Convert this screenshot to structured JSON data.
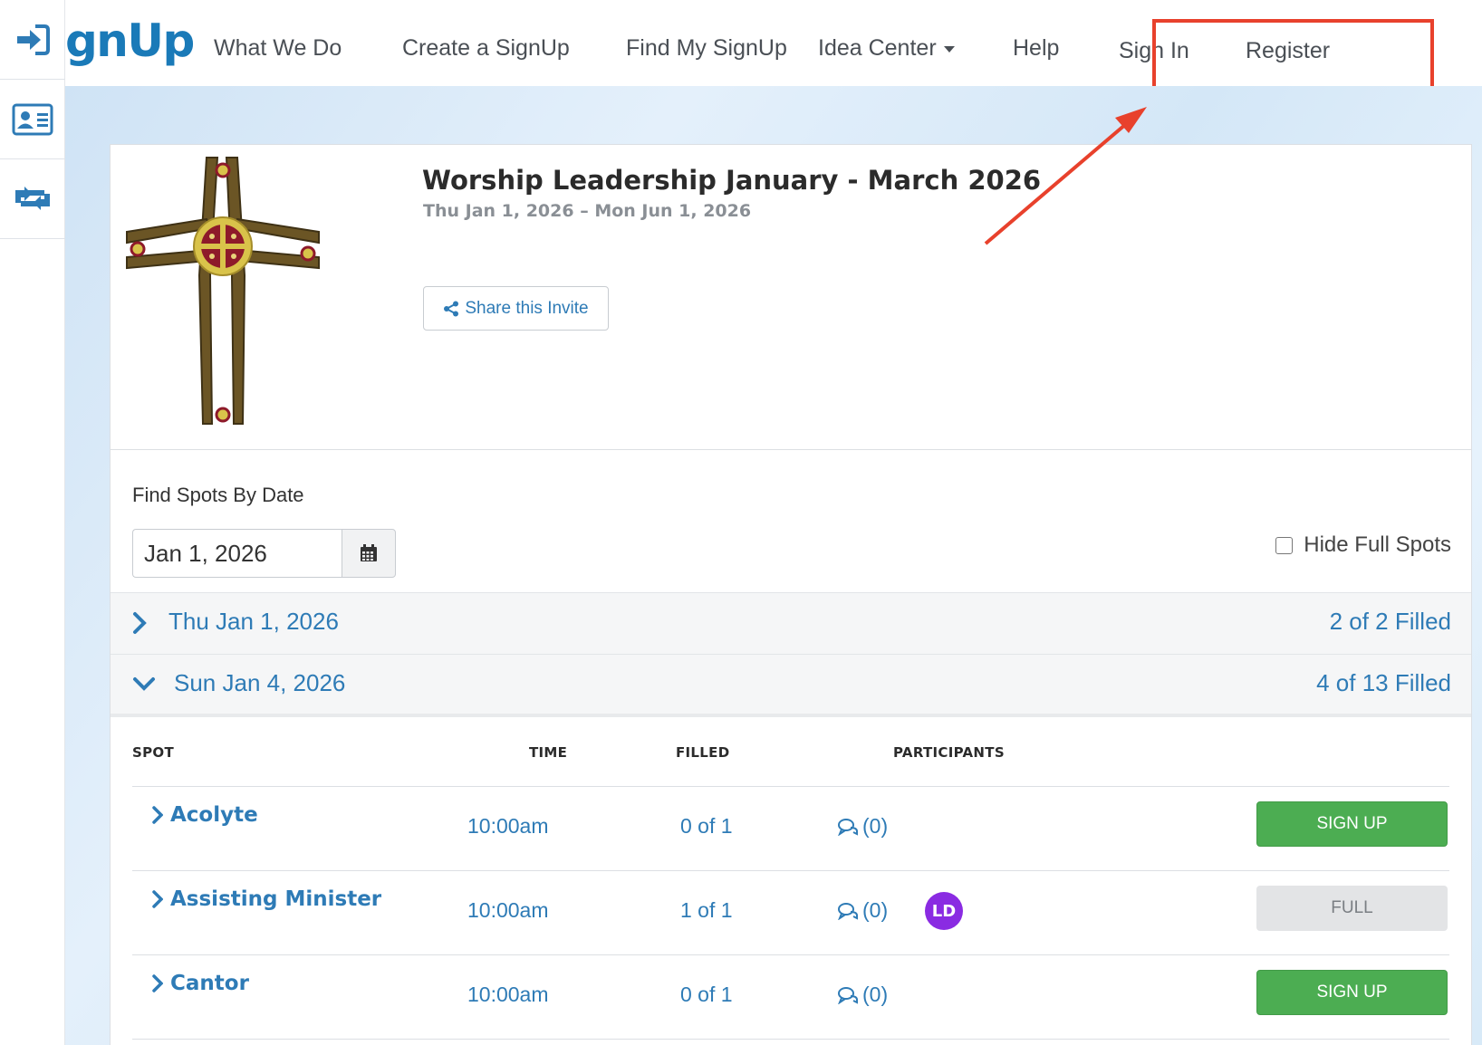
{
  "rail": {
    "items": [
      {
        "icon": "sign-in-icon"
      },
      {
        "icon": "contact-card-icon"
      },
      {
        "icon": "swap-icon"
      }
    ]
  },
  "nav": {
    "logo_text": "gnUp",
    "items": [
      {
        "label": "What We Do"
      },
      {
        "label": "Create a SignUp"
      },
      {
        "label": "Find My SignUp"
      },
      {
        "label": "Idea Center"
      },
      {
        "label": "Help"
      },
      {
        "label": "Sign In"
      },
      {
        "label": "Register"
      }
    ]
  },
  "event": {
    "title": "Worship Leadership January - March 2026",
    "dates": "Thu Jan 1, 2026 – Mon Jun 1, 2026",
    "share_label": "Share this Invite"
  },
  "filters": {
    "find_label": "Find Spots By Date",
    "date_value": "Jan 1, 2026",
    "hide_full_label": "Hide Full Spots"
  },
  "date_groups": [
    {
      "label": "Thu Jan 1, 2026",
      "filled": "2 of 2 Filled",
      "expanded": false
    },
    {
      "label": "Sun Jan 4, 2026",
      "filled": "4 of 13 Filled",
      "expanded": true
    }
  ],
  "table": {
    "headers": {
      "spot": "SPOT",
      "time": "TIME",
      "filled": "FILLED",
      "participants": "PARTICIPANTS"
    },
    "rows": [
      {
        "spot": "Acolyte",
        "time": "10:00am",
        "filled": "0 of 1",
        "comments": "(0)",
        "participant": "",
        "action": "SIGN UP"
      },
      {
        "spot": "Assisting Minister",
        "time": "10:00am",
        "filled": "1 of 1",
        "comments": "(0)",
        "participant": "LD",
        "action": "FULL"
      },
      {
        "spot": "Cantor",
        "time": "10:00am",
        "filled": "0 of 1",
        "comments": "(0)",
        "participant": "",
        "action": "SIGN UP"
      }
    ]
  },
  "colors": {
    "brand": "#1a7ab8",
    "link": "#2e7bb6",
    "signup_green": "#4cad52",
    "annotation_red": "#e8412c",
    "avatar_purple": "#8a2be2"
  }
}
